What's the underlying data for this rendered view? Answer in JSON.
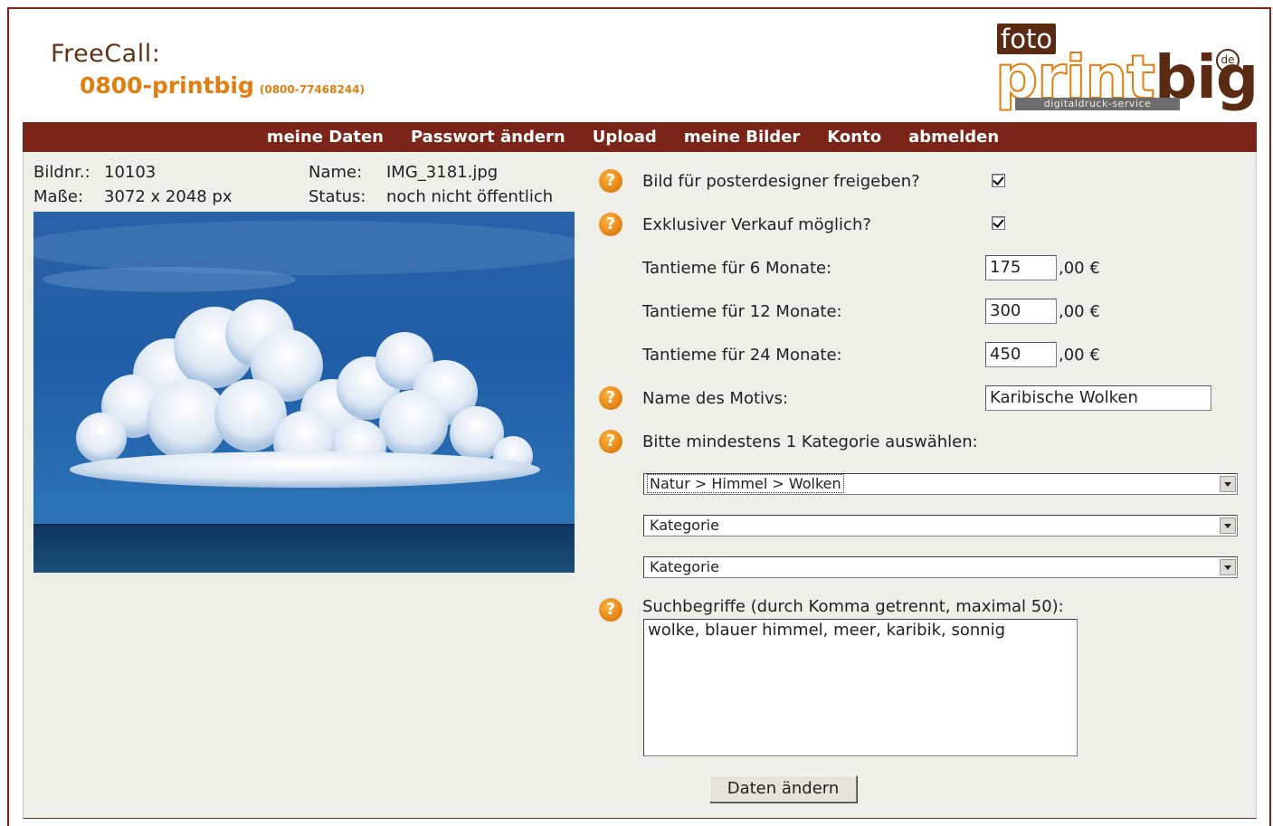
{
  "header": {
    "freecall_label": "FreeCall:",
    "freecall_number": "0800-printbig",
    "freecall_number_alt": "(0800-77468244)",
    "logo": {
      "foto": "foto",
      "brand_a": "print",
      "brand_b": "big",
      "domain": "de",
      "tagline": "digitaldruck-service"
    }
  },
  "nav": {
    "items": [
      "meine Daten",
      "Passwort ändern",
      "Upload",
      "meine Bilder",
      "Konto",
      "abmelden"
    ]
  },
  "image_info": {
    "id_label": "Bildnr.:",
    "id_value": "10103",
    "size_label": "Maße:",
    "size_value": "3072 x 2048 px",
    "name_label": "Name:",
    "name_value": "IMG_3181.jpg",
    "status_label": "Status:",
    "status_value": "noch nicht öffentlich"
  },
  "form": {
    "help_glyph": "?",
    "posterdesigner_label": "Bild für posterdesigner freigeben?",
    "posterdesigner_checked": true,
    "exclusive_label": "Exklusiver Verkauf möglich?",
    "exclusive_checked": true,
    "royalty_6_label": "Tantieme für 6 Monate:",
    "royalty_6_value": "175",
    "royalty_12_label": "Tantieme für 12 Monate:",
    "royalty_12_value": "300",
    "royalty_24_label": "Tantieme für 24 Monate:",
    "royalty_24_value": "450",
    "currency_suffix": ",00 €",
    "motif_label": "Name des Motivs:",
    "motif_value": "Karibische Wolken",
    "category_label": "Bitte mindestens 1 Kategorie auswählen:",
    "category_1": "Natur > Himmel > Wolken",
    "category_2": "Kategorie",
    "category_3": "Kategorie",
    "keywords_label": "Suchbegriffe (durch Komma getrennt, maximal 50):",
    "keywords_value": "wolke, blauer himmel, meer, karibik, sonnig",
    "submit_label": "Daten ändern"
  },
  "colors": {
    "brand_dark": "#7a2517",
    "brand_orange": "#e07f10",
    "panel_bg": "#edefe8"
  }
}
